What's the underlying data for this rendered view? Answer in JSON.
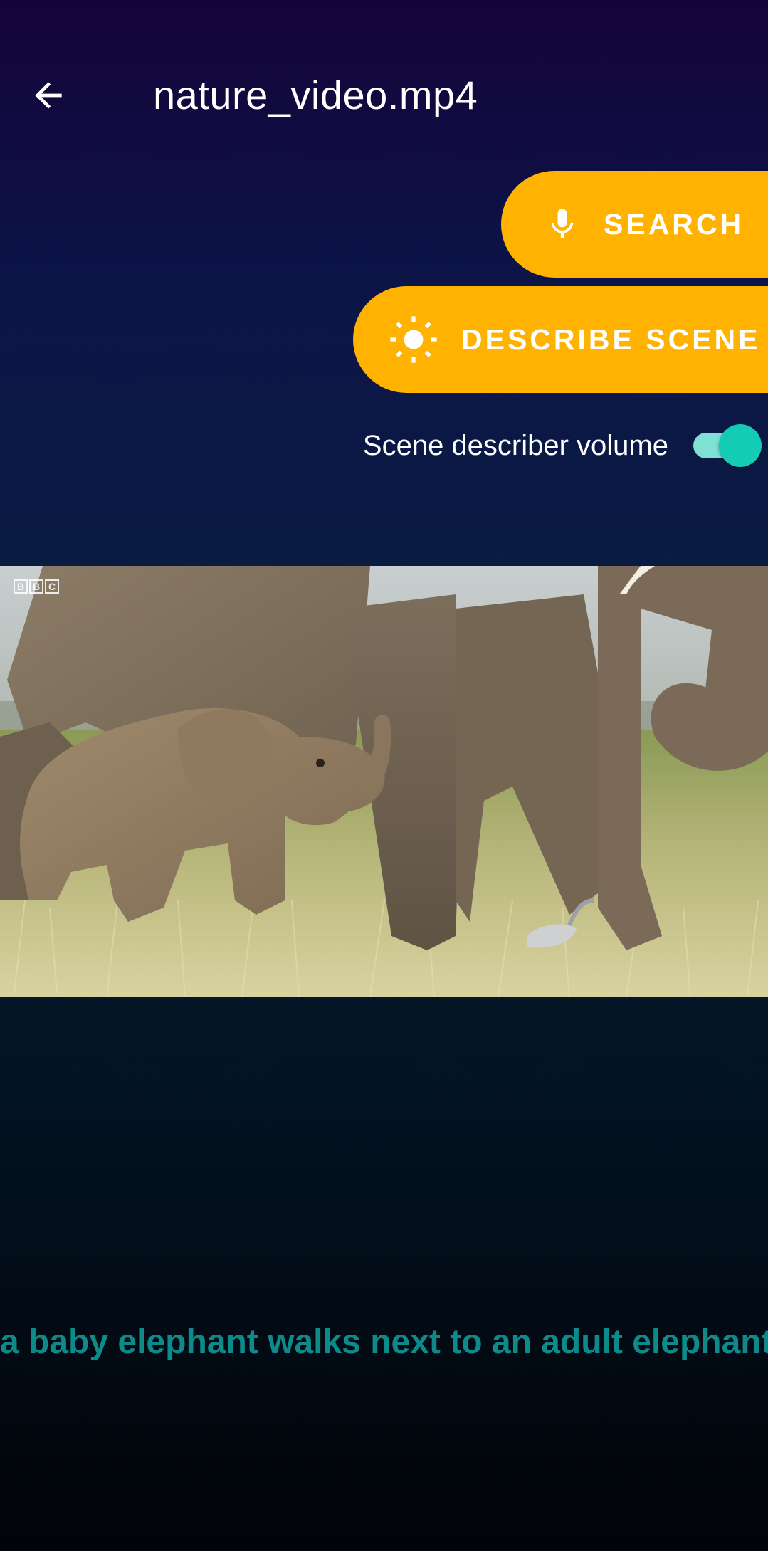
{
  "header": {
    "title": "nature_video.mp4",
    "back_icon": "arrow-left-icon"
  },
  "actions": {
    "search_label": "SEARCH",
    "search_icon": "microphone-icon",
    "describe_label": "DESCRIBE SCENE",
    "describe_icon": "sun-icon",
    "accent_color": "#ffb300"
  },
  "settings": {
    "volume_label": "Scene describer volume",
    "volume_enabled": true,
    "toggle_color": "#14cbb5"
  },
  "video": {
    "watermark": "BBC"
  },
  "caption": {
    "text": "a baby elephant walks next to an adult elephant",
    "color": "#0d8a8a"
  }
}
